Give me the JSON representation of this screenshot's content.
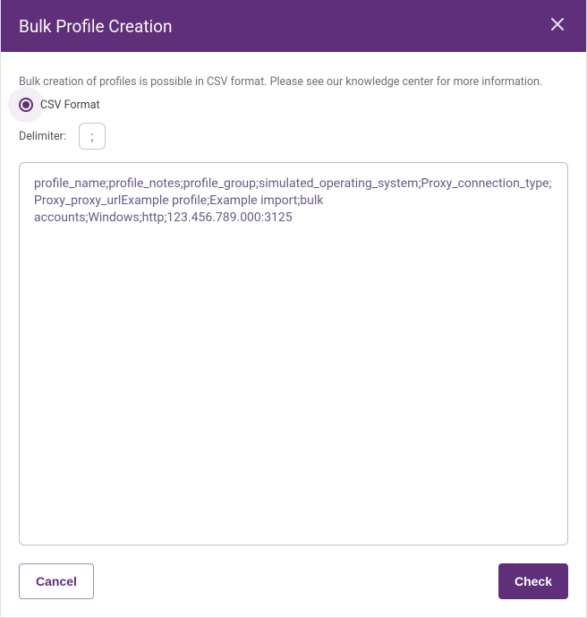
{
  "header": {
    "title": "Bulk Profile Creation"
  },
  "intro": "Bulk creation of profiles is possible in CSV format. Please see our knowledge center for more information.",
  "format": {
    "option_csv_label": "CSV Format"
  },
  "delimiter": {
    "label": "Delimiter:",
    "value": ";"
  },
  "csv": {
    "content": "profile_name;profile_notes;profile_group;simulated_operating_system;Proxy_connection_type;Proxy_proxy_urlExample profile;Example import;bulk accounts;Windows;http;123.456.789.000:3125"
  },
  "footer": {
    "cancel_label": "Cancel",
    "check_label": "Check"
  }
}
